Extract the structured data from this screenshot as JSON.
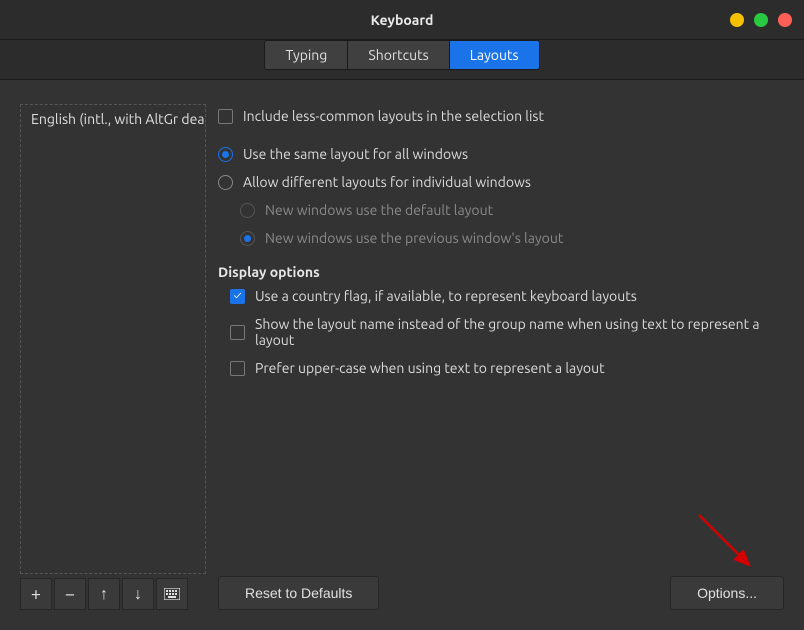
{
  "window": {
    "title": "Keyboard"
  },
  "tabs": {
    "typing": "Typing",
    "shortcuts": "Shortcuts",
    "layouts": "Layouts",
    "active": "layouts"
  },
  "layout_list": {
    "items": [
      "English (intl., with AltGr dead k"
    ]
  },
  "options": {
    "include_less_common": {
      "label": "Include less-common layouts in the selection list",
      "checked": false
    },
    "same_layout_radio": {
      "label": "Use the same layout for all windows",
      "selected": true
    },
    "allow_different_radio": {
      "label": "Allow different layouts for individual windows",
      "selected": false
    },
    "new_windows_default_radio": {
      "label": "New windows use the default layout",
      "selected": false,
      "enabled": false
    },
    "new_windows_previous_radio": {
      "label": "New windows use the previous window's layout",
      "selected": true,
      "enabled": false
    },
    "display_options_title": "Display options",
    "country_flag": {
      "label": "Use a country flag, if available,  to represent keyboard layouts",
      "checked": true
    },
    "show_layout_name": {
      "label": "Show the layout name instead of the group name when using text to represent a layout",
      "checked": false
    },
    "prefer_upper": {
      "label": "Prefer upper-case when using text to represent a layout",
      "checked": false
    }
  },
  "buttons": {
    "reset": "Reset to Defaults",
    "options": "Options..."
  },
  "toolbar_icons": {
    "add": "+",
    "remove": "−",
    "up": "arrow-up",
    "down": "arrow-down",
    "keyboard": "keyboard"
  }
}
